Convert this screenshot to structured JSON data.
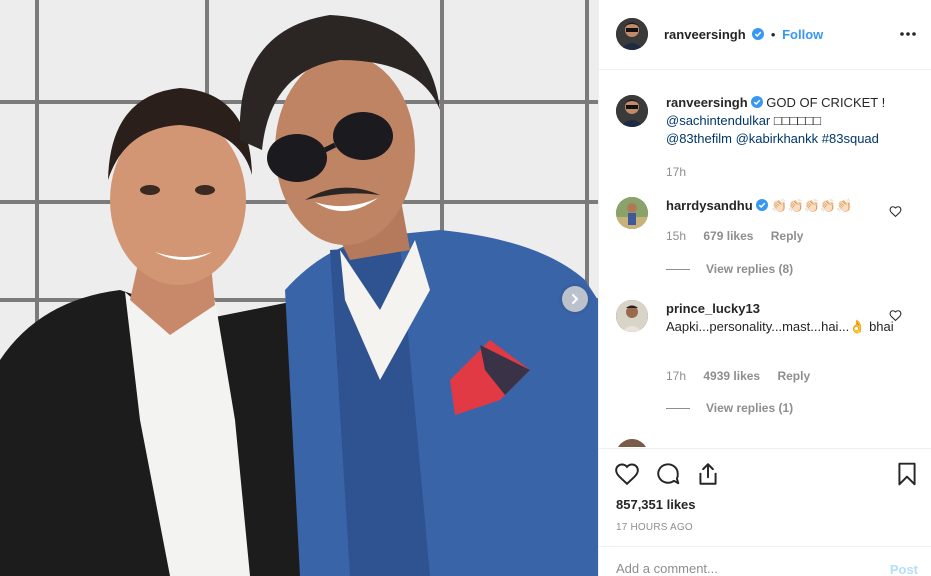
{
  "post": {
    "author": "ranveersingh",
    "follow_label": "Follow",
    "more_icon": "more-horizontal-icon"
  },
  "caption": {
    "author": "ranveersingh",
    "text": "GOD OF CRICKET !",
    "mention_1": "@sachintendulkar",
    "emoji_row": "□□□□□□",
    "mention_2": "@83thefilm",
    "mention_3": "@kabirkhankk",
    "hashtag": "#83squad",
    "time": "17h"
  },
  "comments": [
    {
      "author": "harrdysandhu",
      "text": "👏🏻👏🏻👏🏻👏🏻👏🏻",
      "time": "15h",
      "likes": "679 likes",
      "reply_label": "Reply",
      "view_replies": "View replies (8)"
    },
    {
      "author": "prince_lucky13",
      "text": "Aapki...personality...mast...hai...👌 bhai",
      "time": "17h",
      "likes": "4939 likes",
      "reply_label": "Reply",
      "view_replies": "View replies (1)"
    }
  ],
  "actions": {
    "like_icon": "heart-icon",
    "comment_icon": "comment-icon",
    "share_icon": "share-icon",
    "save_icon": "bookmark-icon"
  },
  "likes_count": "857,351 likes",
  "timestamp": "17 HOURS AGO",
  "add_comment": {
    "placeholder": "Add a comment...",
    "post_label": "Post"
  },
  "colors": {
    "link": "#00376b",
    "accent": "#3897f0",
    "muted": "#8e8e8e",
    "post_disabled": "#b2dffc"
  }
}
